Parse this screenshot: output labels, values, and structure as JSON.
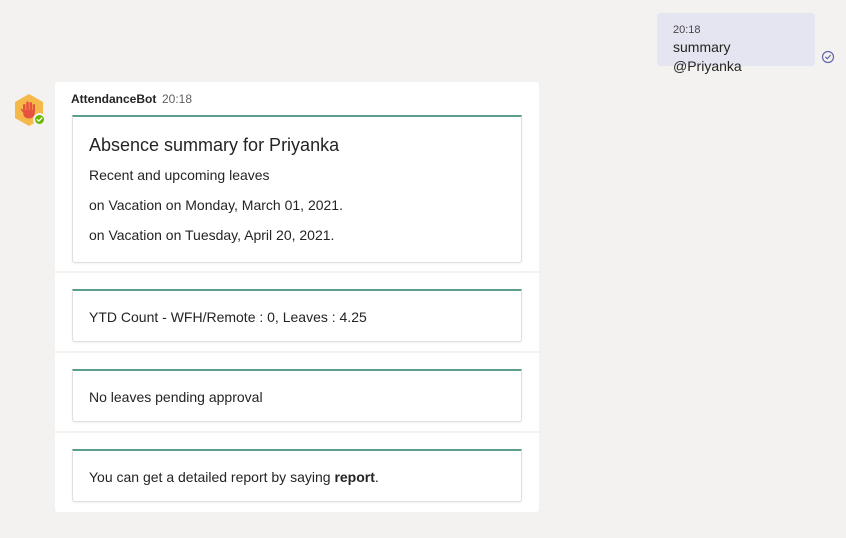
{
  "outgoing": {
    "time": "20:18",
    "text": "summary @Priyanka",
    "read_icon": "check-circle-icon"
  },
  "bot": {
    "sender": "AttendanceBot",
    "time": "20:18",
    "avatar_icon": "raised-hand-icon",
    "status_icon": "available-check-icon",
    "colors": {
      "avatar": "#f5b94a",
      "card_accent": "#5b9e8d",
      "status": "#6bb700"
    }
  },
  "cards": {
    "summary": {
      "title": "Absence summary for Priyanka",
      "subtitle": "Recent and upcoming leaves",
      "leaves": [
        "on Vacation on Monday, March 01, 2021.",
        "on Vacation on Tuesday, April 20, 2021."
      ]
    },
    "ytd": {
      "text": "YTD Count - WFH/Remote : 0, Leaves : 4.25"
    },
    "pending": {
      "text": "No leaves pending approval"
    },
    "report": {
      "prefix": "You can get a detailed report by saying ",
      "keyword": "report",
      "suffix": "."
    }
  }
}
